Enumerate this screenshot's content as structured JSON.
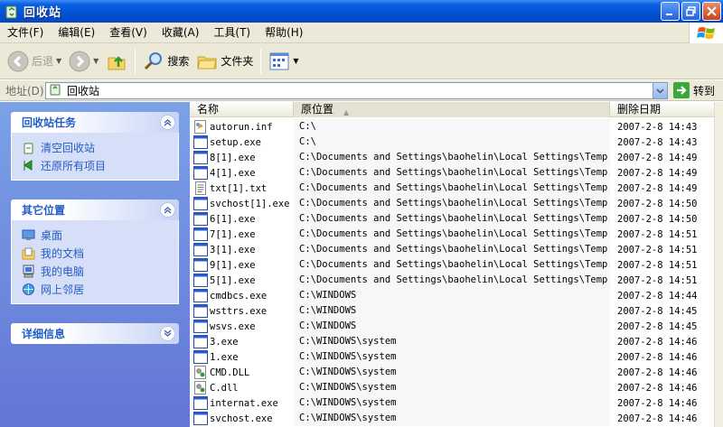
{
  "window": {
    "title": "回收站"
  },
  "menu": [
    "文件(F)",
    "编辑(E)",
    "查看(V)",
    "收藏(A)",
    "工具(T)",
    "帮助(H)"
  ],
  "toolbar": {
    "back_label": "后退",
    "search_label": "搜索",
    "folders_label": "文件夹"
  },
  "address": {
    "label": "地址(D)",
    "value": "回收站",
    "go_label": "转到"
  },
  "taskpane": {
    "recycle_tasks": {
      "title": "回收站任务",
      "items": [
        "清空回收站",
        "还原所有项目"
      ]
    },
    "other_places": {
      "title": "其它位置",
      "items": [
        "桌面",
        "我的文档",
        "我的电脑",
        "网上邻居"
      ]
    },
    "details": {
      "title": "详细信息"
    }
  },
  "columns": {
    "name": "名称",
    "location": "原位置",
    "date": "删除日期"
  },
  "files": [
    {
      "name": "autorun.inf",
      "location": "C:\\",
      "date": "2007-2-8 14:43",
      "icon": "inf"
    },
    {
      "name": "setup.exe",
      "location": "C:\\",
      "date": "2007-2-8 14:43",
      "icon": "exe"
    },
    {
      "name": "8[1].exe",
      "location": "C:\\Documents and Settings\\baohelin\\Local Settings\\Temp...",
      "date": "2007-2-8 14:49",
      "icon": "exe"
    },
    {
      "name": "4[1].exe",
      "location": "C:\\Documents and Settings\\baohelin\\Local Settings\\Temp...",
      "date": "2007-2-8 14:49",
      "icon": "exe"
    },
    {
      "name": "txt[1].txt",
      "location": "C:\\Documents and Settings\\baohelin\\Local Settings\\Temp...",
      "date": "2007-2-8 14:49",
      "icon": "txt"
    },
    {
      "name": "svchost[1].exe",
      "location": "C:\\Documents and Settings\\baohelin\\Local Settings\\Temp...",
      "date": "2007-2-8 14:50",
      "icon": "exe"
    },
    {
      "name": "6[1].exe",
      "location": "C:\\Documents and Settings\\baohelin\\Local Settings\\Temp...",
      "date": "2007-2-8 14:50",
      "icon": "exe"
    },
    {
      "name": "7[1].exe",
      "location": "C:\\Documents and Settings\\baohelin\\Local Settings\\Temp...",
      "date": "2007-2-8 14:51",
      "icon": "exe"
    },
    {
      "name": "3[1].exe",
      "location": "C:\\Documents and Settings\\baohelin\\Local Settings\\Temp...",
      "date": "2007-2-8 14:51",
      "icon": "exe"
    },
    {
      "name": "9[1].exe",
      "location": "C:\\Documents and Settings\\baohelin\\Local Settings\\Temp...",
      "date": "2007-2-8 14:51",
      "icon": "exe"
    },
    {
      "name": "5[1].exe",
      "location": "C:\\Documents and Settings\\baohelin\\Local Settings\\Temp...",
      "date": "2007-2-8 14:51",
      "icon": "exe"
    },
    {
      "name": "cmdbcs.exe",
      "location": "C:\\WINDOWS",
      "date": "2007-2-8 14:44",
      "icon": "exe"
    },
    {
      "name": "wsttrs.exe",
      "location": "C:\\WINDOWS",
      "date": "2007-2-8 14:45",
      "icon": "exe"
    },
    {
      "name": "wsvs.exe",
      "location": "C:\\WINDOWS",
      "date": "2007-2-8 14:45",
      "icon": "exe"
    },
    {
      "name": "3.exe",
      "location": "C:\\WINDOWS\\system",
      "date": "2007-2-8 14:46",
      "icon": "exe"
    },
    {
      "name": "1.exe",
      "location": "C:\\WINDOWS\\system",
      "date": "2007-2-8 14:46",
      "icon": "exe"
    },
    {
      "name": "CMD.DLL",
      "location": "C:\\WINDOWS\\system",
      "date": "2007-2-8 14:46",
      "icon": "dll"
    },
    {
      "name": "C.dll",
      "location": "C:\\WINDOWS\\system",
      "date": "2007-2-8 14:46",
      "icon": "dll"
    },
    {
      "name": "internat.exe",
      "location": "C:\\WINDOWS\\system",
      "date": "2007-2-8 14:46",
      "icon": "exe"
    },
    {
      "name": "svchost.exe",
      "location": "C:\\WINDOWS\\system",
      "date": "2007-2-8 14:46",
      "icon": "exe"
    }
  ]
}
